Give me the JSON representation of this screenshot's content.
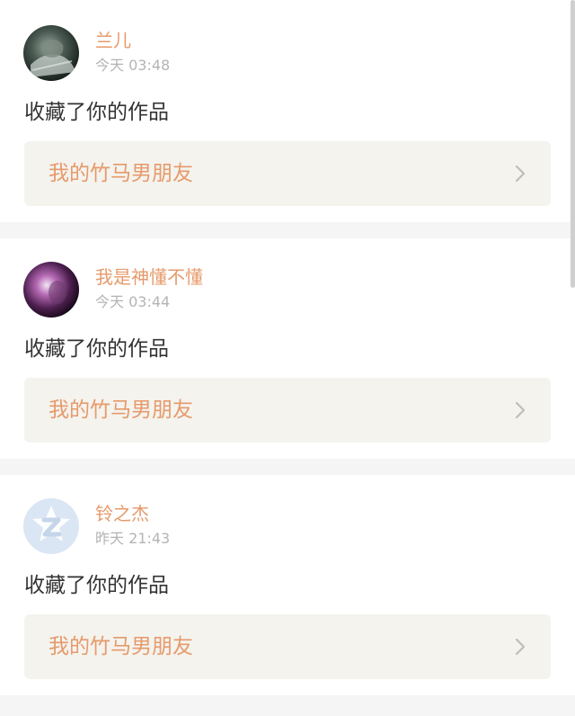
{
  "colors": {
    "accent": "#e69a6b",
    "card_link_bg": "#f4f3ee",
    "time": "#b4b4b4",
    "text": "#333333",
    "chevron": "#bdbdbd"
  },
  "notifications": [
    {
      "username": "兰儿",
      "time": "今天 03:48",
      "action": "收藏了你的作品",
      "work_title": "我的竹马男朋友",
      "avatar_icon": "dark-photo-avatar"
    },
    {
      "username": "我是神懂不懂",
      "time": "今天 03:44",
      "action": "收藏了你的作品",
      "work_title": "我的竹马男朋友",
      "avatar_icon": "purple-glow-avatar"
    },
    {
      "username": "铃之杰",
      "time": "昨天 21:43",
      "action": "收藏了你的作品",
      "work_title": "我的竹马男朋友",
      "avatar_icon": "qq-default-avatar"
    }
  ]
}
